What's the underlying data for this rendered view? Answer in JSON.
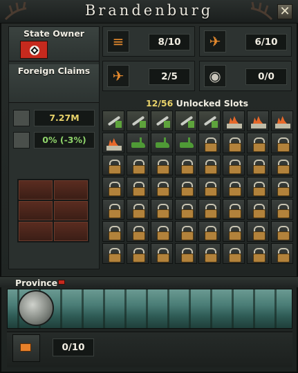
{
  "window": {
    "title": "Brandenburg",
    "close_label": "✕"
  },
  "left": {
    "state_owner_label": "State Owner",
    "foreign_claims_label": "Foreign Claims",
    "population": "7.27M",
    "resistance": "0% (-3%)"
  },
  "resources": [
    {
      "icon": "infrastructure-icon",
      "value": "8/10"
    },
    {
      "icon": "air-base-icon",
      "value": "6/10"
    },
    {
      "icon": "airport-icon",
      "value": "2/5"
    },
    {
      "icon": "radar-icon",
      "value": "0/0"
    }
  ],
  "slots": {
    "unlocked": "12",
    "total": "/56",
    "label": " Unlocked Slots",
    "rows": [
      [
        "mil",
        "mil",
        "mil",
        "mil",
        "mil",
        "civ",
        "civ",
        "civ"
      ],
      [
        "civ",
        "dock",
        "dock",
        "dock",
        "locked",
        "locked",
        "locked",
        "locked"
      ],
      [
        "locked",
        "locked",
        "locked",
        "locked",
        "locked",
        "locked",
        "locked",
        "locked"
      ],
      [
        "locked",
        "locked",
        "locked",
        "locked",
        "locked",
        "locked",
        "locked",
        "locked"
      ],
      [
        "locked",
        "locked",
        "locked",
        "locked",
        "locked",
        "locked",
        "locked",
        "locked"
      ],
      [
        "locked",
        "locked",
        "locked",
        "locked",
        "locked",
        "locked",
        "locked",
        "locked"
      ],
      [
        "locked",
        "locked",
        "locked",
        "locked",
        "locked",
        "locked",
        "locked",
        "locked"
      ]
    ]
  },
  "province": {
    "label": "Province"
  },
  "bottom": {
    "value": "0/10"
  },
  "colors": {
    "highlight_yellow": "#e9d36a",
    "positive_green": "#8fd46b",
    "locked_slot_gold": "#b2823b"
  }
}
